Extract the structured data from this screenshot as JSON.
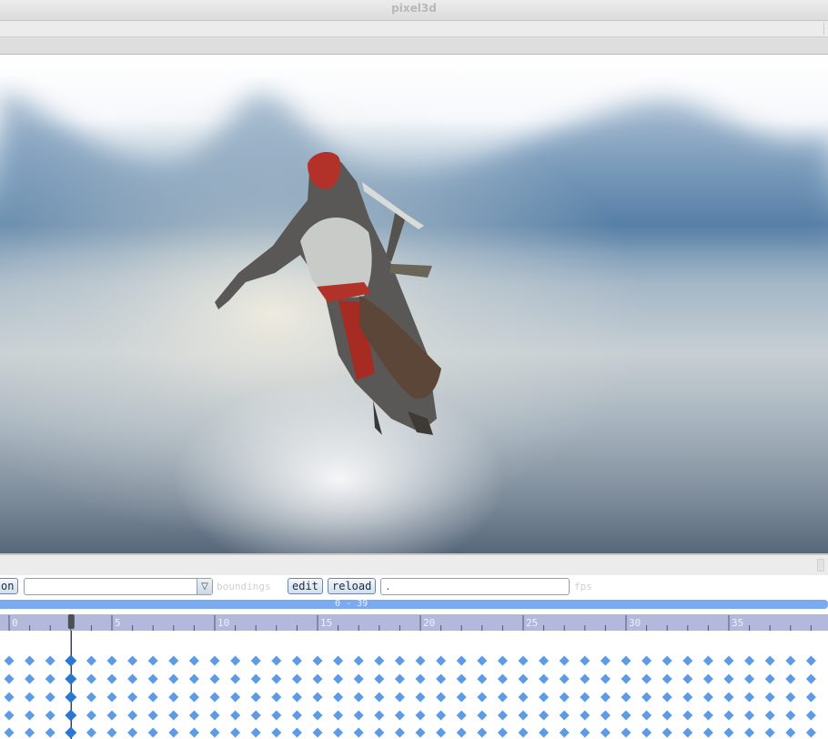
{
  "window": {
    "title": "pixel3d"
  },
  "controls": {
    "left_button_label": "on",
    "animation_select_value": "",
    "dropdown_arrow": "▽",
    "bones_label": "boundings",
    "edit_label": "edit",
    "reload_label": "reload",
    "fps_value": ".",
    "fps_label": "fps"
  },
  "timeline": {
    "range_label": "0 - 39",
    "frame_count": 40,
    "current_frame": 3,
    "tick_labels": [
      "0",
      "5",
      "10",
      "15",
      "20",
      "25",
      "30",
      "35"
    ],
    "track_count": 5
  },
  "colors": {
    "accent": "#7aaaf0",
    "ruler": "#b2b9db",
    "keyframe": "#5d9be6",
    "keyframe_active": "#2a78d6"
  },
  "icons": [
    "dropdown-arrow-icon",
    "playhead-icon",
    "keyframe-icon",
    "resize-grip-icon"
  ]
}
